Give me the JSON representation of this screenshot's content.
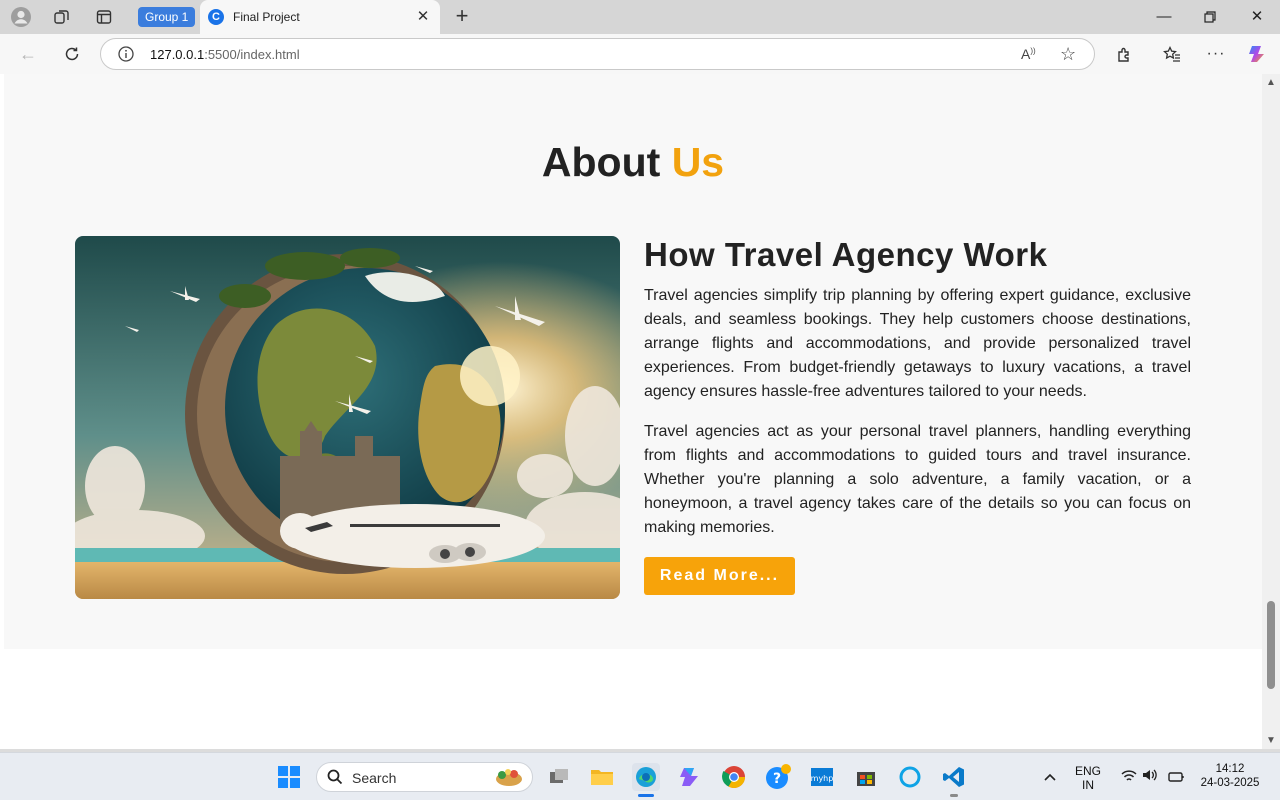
{
  "browser": {
    "group_label": "Group 1",
    "tab_title": "Final Project",
    "url_host": "127.0.0.1",
    "url_path": ":5500/index.html"
  },
  "about": {
    "title_main": "About",
    "title_accent": "Us",
    "heading": "How Travel Agency Work",
    "paragraph_1": "Travel agencies simplify trip planning by offering expert guidance, exclusive deals, and seamless bookings. They help customers choose destinations, arrange flights and accommodations, and provide personalized travel experiences. From budget-friendly getaways to luxury vacations, a travel agency ensures hassle-free adventures tailored to your needs.",
    "paragraph_2": "Travel agencies act as your personal travel planners, handling everything from flights and accommodations to guided tours and travel insurance. Whether you're planning a solo adventure, a family vacation, or a honeymoon, a travel agency takes care of the details so you can focus on making memories.",
    "button_label": "Read More...",
    "accent_color": "#f2a20e"
  },
  "taskbar": {
    "search_label": "Search",
    "lang_line1": "ENG",
    "lang_line2": "IN",
    "time": "14:12",
    "date": "24-03-2025"
  }
}
